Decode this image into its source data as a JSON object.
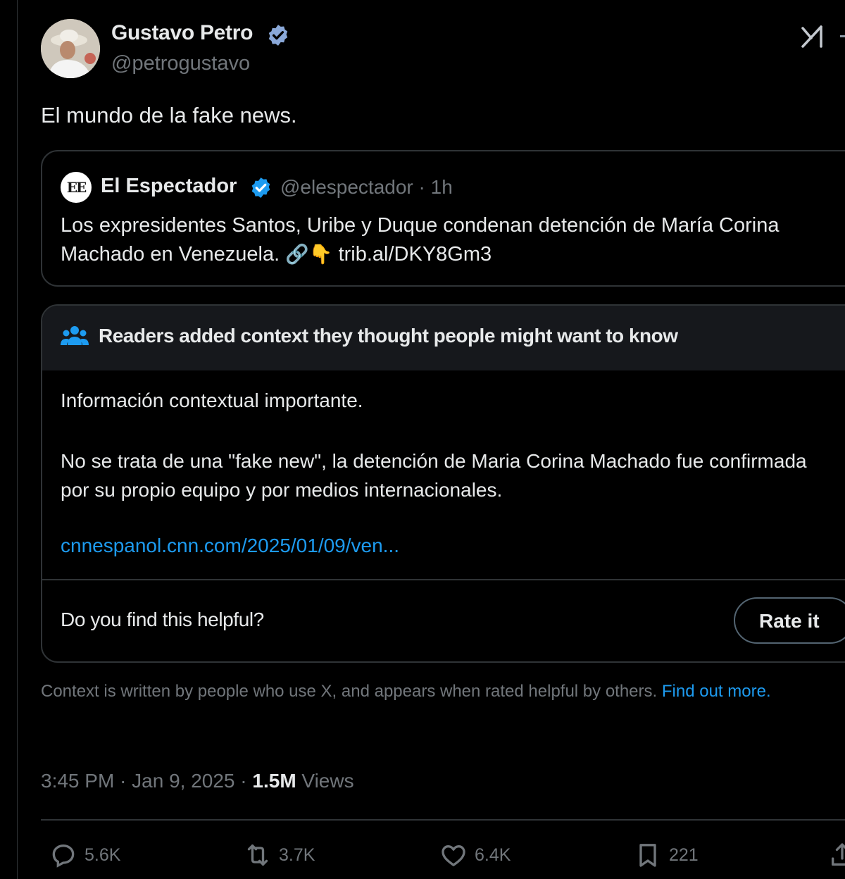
{
  "author": {
    "name": "Gustavo Petro",
    "handle": "@petrogustavo"
  },
  "tweet": {
    "text": "El mundo de la fake news."
  },
  "quoted": {
    "logo_text": "EE",
    "name": "El Espectador",
    "meta": "@elespectador · 1h",
    "text_line1": "Los expresidentes Santos, Uribe y Duque condenan detención de María Corina",
    "text_line2": "Machado en Venezuela.",
    "emoji": "🔗👇",
    "link": "trib.al/DKY8Gm3"
  },
  "note": {
    "header": "Readers added context they thought people might want to know",
    "p1": "Información contextual importante.",
    "p2": "No se trata de una \"fake new\", la detención de Maria Corina Machado fue confirmada por su propio equipo y por medios internacionales.",
    "link": "cnnespanol.cnn.com/2025/01/09/ven...",
    "helpful_question": "Do you find this helpful?",
    "rate_label": "Rate it"
  },
  "context_footer": {
    "text": "Context is written by people who use X, and appears when rated helpful by others.",
    "link": "Find out more."
  },
  "meta": {
    "time": "3:45 PM · Jan 9, 2025 · ",
    "views_count": "1.5M",
    "views_label": " Views"
  },
  "actions": {
    "replies": "5.6K",
    "reposts": "3.7K",
    "likes": "6.4K",
    "bookmarks": "221"
  },
  "colors": {
    "background": "#000000",
    "accent": "#1d9bf0",
    "secondary_text": "#71767b",
    "border": "#2f3336"
  },
  "icons": {
    "verified": "verified-badge-icon",
    "grok": "grok-icon",
    "note_people": "people-icon",
    "reply": "reply-icon",
    "repost": "repost-icon",
    "like": "heart-icon",
    "bookmark": "bookmark-icon",
    "share": "share-icon"
  }
}
